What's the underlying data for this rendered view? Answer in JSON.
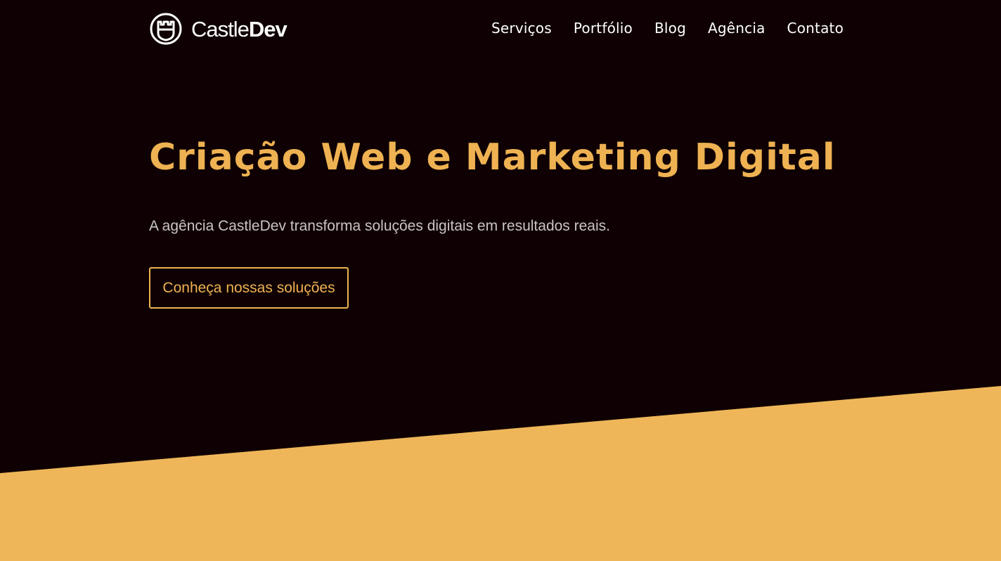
{
  "logo": {
    "name_light": "Castle",
    "name_bold": "Dev",
    "icon": "castle-crest-icon"
  },
  "nav": {
    "items": [
      {
        "label": "Serviços"
      },
      {
        "label": "Portfólio"
      },
      {
        "label": "Blog"
      },
      {
        "label": "Agência"
      },
      {
        "label": "Contato"
      }
    ]
  },
  "hero": {
    "title": "Criação Web e Marketing Digital",
    "subtitle": "A agência CastleDev transforma soluções digitais em resultados reais.",
    "cta_label": "Conheça nossas soluções"
  },
  "colors": {
    "background": "#0f0103",
    "accent": "#efb252",
    "nav_text": "#ffffff",
    "subtitle_text": "#c9c4c4"
  }
}
